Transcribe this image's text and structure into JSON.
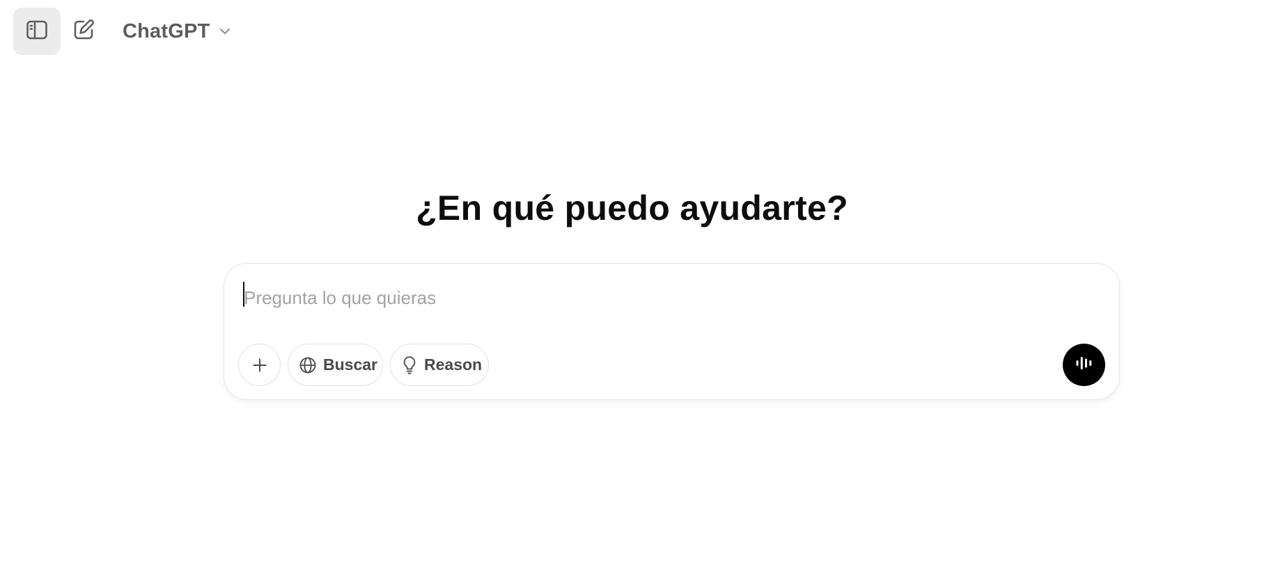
{
  "app": {
    "model_name": "ChatGPT"
  },
  "topbar": {
    "sidebar_toggle_icon": "sidebar-toggle-icon",
    "new_chat_icon": "edit-icon",
    "model_chevron_icon": "chevron-down-icon"
  },
  "main": {
    "headline": "¿En qué puedo ayudarte?"
  },
  "composer": {
    "placeholder": "Pregunta lo que quieras",
    "value": "",
    "attach_icon": "plus-icon",
    "search_label": "Buscar",
    "search_icon": "globe-icon",
    "reason_label": "Reason",
    "reason_icon": "lightbulb-icon",
    "voice_icon": "voice-waveform-icon"
  },
  "colors": {
    "background": "#ffffff",
    "sidebar_toggle_bg": "#ececec",
    "voice_button_bg": "#000000",
    "placeholder": "#a3a3a3",
    "text_primary": "#0d0d0d"
  }
}
